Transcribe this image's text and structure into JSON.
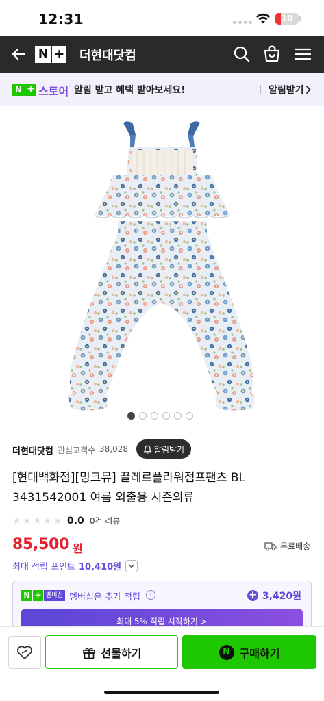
{
  "status_bar": {
    "time": "12:31",
    "battery": "10"
  },
  "header": {
    "logo_n": "N",
    "logo_plus": "+",
    "store_name": "더현대닷컴"
  },
  "banner": {
    "logo_n": "N",
    "logo_plus": "+",
    "store": "스토어",
    "text": "알림 받고 혜택 받아보세요!",
    "action": "알림받기"
  },
  "carousel": {
    "pages": 6,
    "current": 1
  },
  "seller": {
    "name": "더현대닷컴",
    "fans_label": "관심고객수",
    "fans_count": "38,028",
    "alarm_label": "알림받기"
  },
  "product": {
    "title_line1": "[현대백화점][밍크뮤] 끌레르플라워점프팬츠 BL",
    "title_line2": "3431542001 여름 외출용 시즌의류",
    "rating": "0.0",
    "review_count": "0건 리뷰",
    "price": "85,500",
    "price_unit": "원",
    "shipping": "무료배송",
    "points_label": "최대 적립 포인트",
    "points_value": "10,410원"
  },
  "membership": {
    "badge_n": "N",
    "badge_plus": "+",
    "badge_text": "멤버십",
    "text": "멤버십은 추가 적립",
    "amount": "3,420원",
    "cta": "최대 5% 적립 시작하기 >"
  },
  "bottom_bar": {
    "gift_label": "선물하기",
    "buy_label": "구매하기",
    "buy_icon": "N"
  },
  "colors": {
    "header_bg": "#2a2a2a",
    "naver_green": "#1ec800",
    "price_red": "#e3202c",
    "purple": "#6a4fd8"
  }
}
